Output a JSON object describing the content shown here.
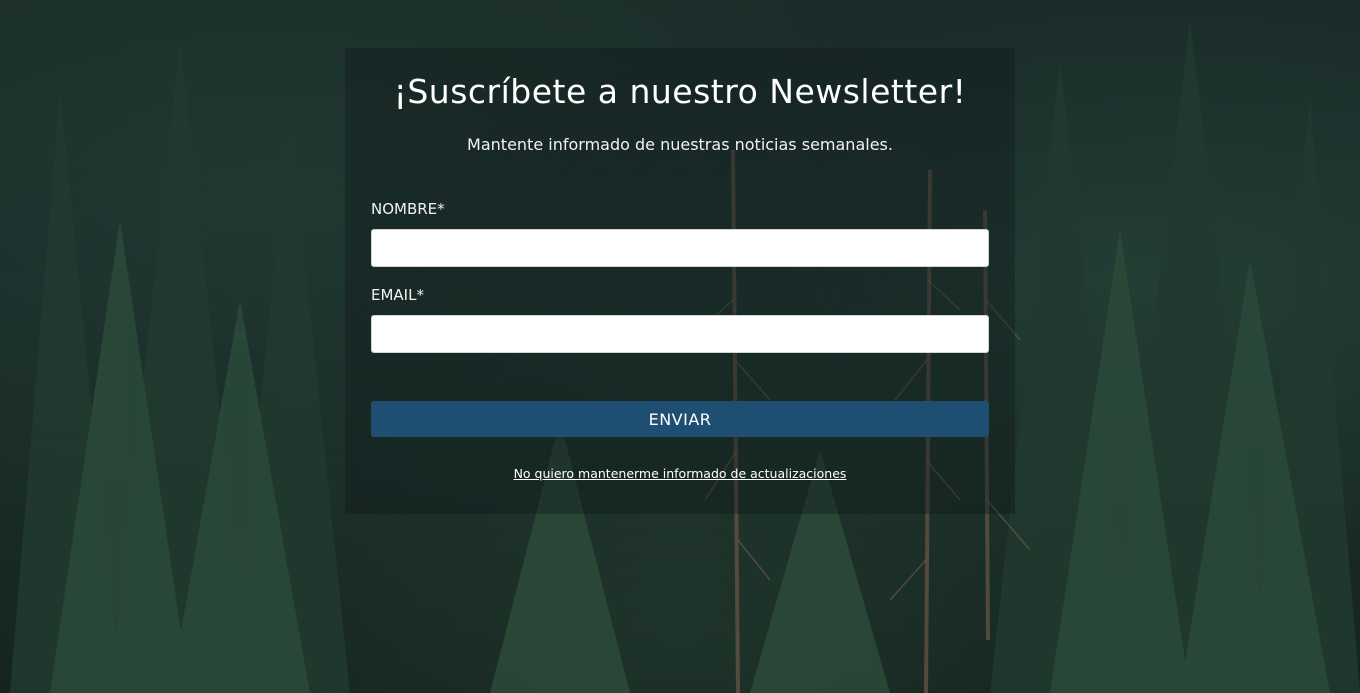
{
  "newsletter": {
    "title": "¡Suscríbete a nuestro Newsletter!",
    "subtitle": "Mantente informado de nuestras noticias semanales.",
    "name_label": "NOMBRE*",
    "name_value": "",
    "name_placeholder": "",
    "email_label": "EMAIL*",
    "email_value": "",
    "email_placeholder": "",
    "submit_label": "ENVIAR",
    "unsubscribe_link": "No quiero mantenerme informado de actualizaciones"
  },
  "colors": {
    "button_bg": "#1f4e73",
    "text": "#ffffff"
  }
}
